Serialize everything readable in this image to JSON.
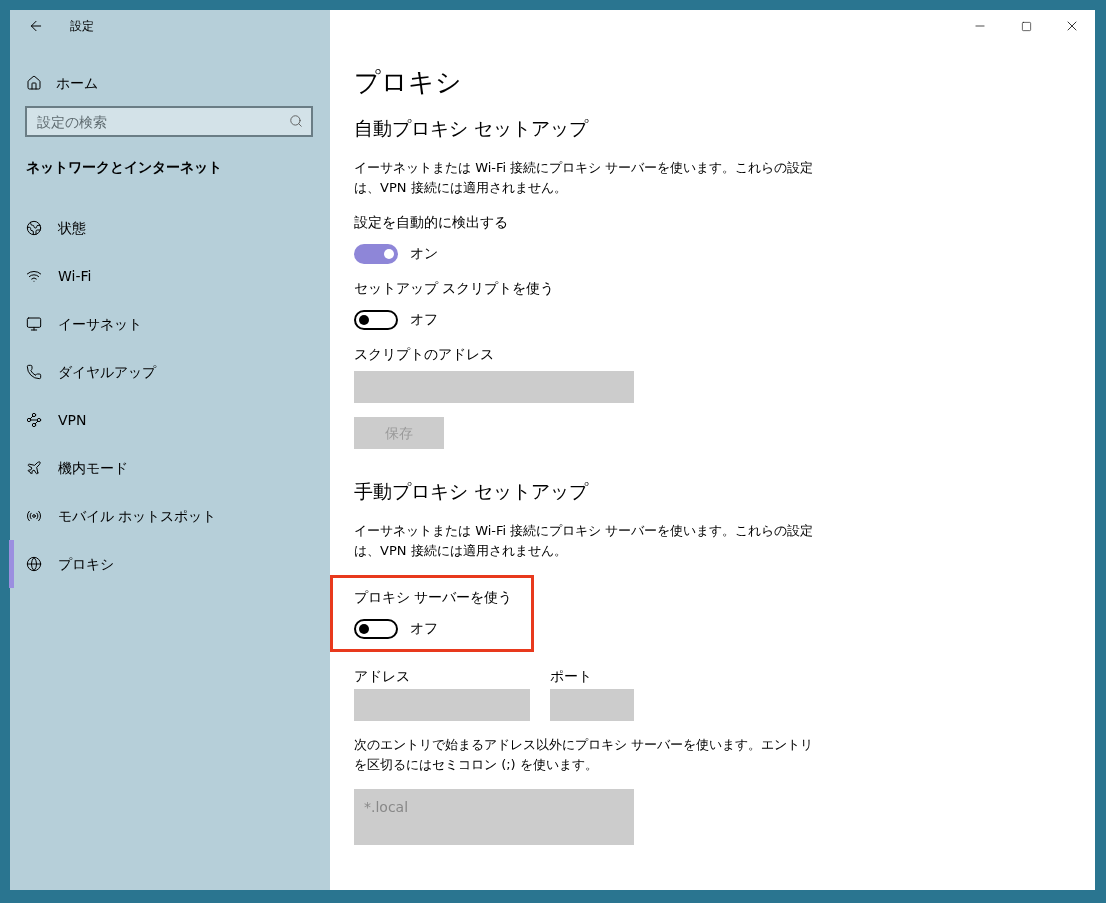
{
  "window": {
    "title": "設定"
  },
  "sidebar": {
    "home": "ホーム",
    "search": {
      "placeholder": "設定の検索"
    },
    "section": "ネットワークとインターネット",
    "items": [
      {
        "label": "状態",
        "kind": "status",
        "selected": false
      },
      {
        "label": "Wi-Fi",
        "kind": "wifi",
        "selected": false
      },
      {
        "label": "イーサネット",
        "kind": "ethernet",
        "selected": false
      },
      {
        "label": "ダイヤルアップ",
        "kind": "dialup",
        "selected": false
      },
      {
        "label": "VPN",
        "kind": "vpn",
        "selected": false
      },
      {
        "label": "機内モード",
        "kind": "airplane",
        "selected": false
      },
      {
        "label": "モバイル ホットスポット",
        "kind": "hotspot",
        "selected": false
      },
      {
        "label": "プロキシ",
        "kind": "proxy",
        "selected": true
      }
    ]
  },
  "page": {
    "title": "プロキシ",
    "sections": [
      {
        "heading": "自動プロキシ セットアップ",
        "items": [
          {
            "kind": "text",
            "text": "イーサネットまたは Wi-Fi 接続にプロキシ サーバーを使います。これらの設定は、VPN 接続には適用されません。"
          },
          {
            "kind": "toggle",
            "label": "設定を自動的に検出する",
            "on": true,
            "state_text": "オン",
            "highlighted": false
          },
          {
            "kind": "toggle",
            "label": "セットアップ スクリプトを使う",
            "on": false,
            "state_text": "オフ",
            "highlighted": false
          },
          {
            "kind": "field",
            "label": "スクリプトのアドレス",
            "disabled": true
          },
          {
            "kind": "button",
            "label": "保存",
            "disabled": true
          }
        ]
      },
      {
        "heading": "手動プロキシ セットアップ",
        "items": [
          {
            "kind": "text",
            "text": "イーサネットまたは Wi-Fi 接続にプロキシ サーバーを使います。これらの設定は、VPN 接続には適用されません。"
          },
          {
            "kind": "toggle",
            "label": "プロキシ サーバーを使う",
            "on": false,
            "state_text": "オフ",
            "highlighted": true
          },
          {
            "kind": "address_port",
            "address_label": "アドレス",
            "port_label": "ポート",
            "disabled": true
          },
          {
            "kind": "text",
            "text": "次のエントリで始まるアドレス以外にプロキシ サーバーを使います。エントリを区切るにはセミコロン (;) を使います。"
          },
          {
            "kind": "textarea",
            "value": "*.local",
            "disabled": true
          }
        ]
      }
    ]
  }
}
